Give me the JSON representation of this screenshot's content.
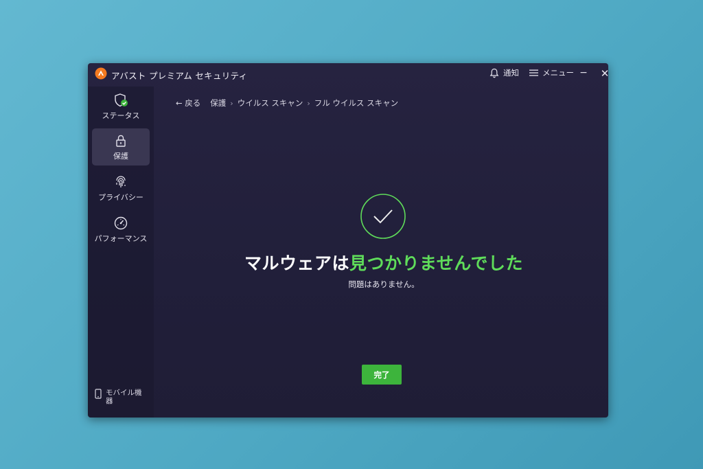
{
  "app": {
    "title": "アバスト プレミアム セキュリティ",
    "accent_color": "#f47a20"
  },
  "header": {
    "notifications_label": "通知",
    "menu_label": "メニュー",
    "minimize_glyph": "−",
    "close_glyph": "✕"
  },
  "sidebar": {
    "items": [
      {
        "label": "ステータス",
        "icon": "shield-check-icon"
      },
      {
        "label": "保護",
        "icon": "lock-icon",
        "active": true
      },
      {
        "label": "プライバシー",
        "icon": "fingerprint-icon"
      },
      {
        "label": "パフォーマンス",
        "icon": "speedometer-icon"
      }
    ],
    "mobile_label": "モバイル機器"
  },
  "breadcrumb": {
    "back_label": "← 戻る",
    "items": [
      "保護",
      "ウイルス スキャン",
      "フル ウイルス スキャン"
    ],
    "separator": "›"
  },
  "result": {
    "headline_white": "マルウェアは",
    "headline_green": "見つかりませんでした",
    "subtext": "問題はありません。",
    "status_color": "#5fdc5a"
  },
  "actions": {
    "done_label": "完了",
    "done_color": "#3db43c"
  }
}
